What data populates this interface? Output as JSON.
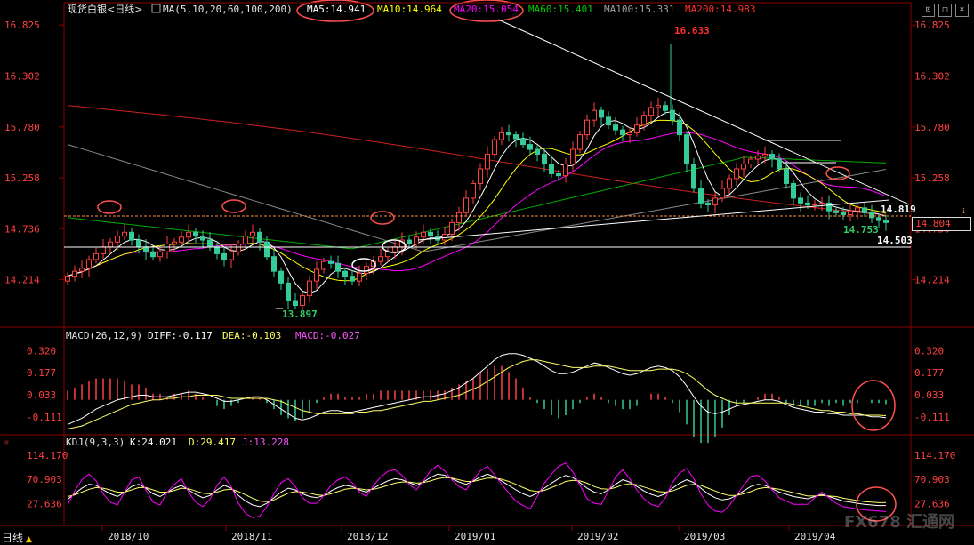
{
  "header": {
    "symbol": "现货白银<日线>",
    "ma_prefix": "MA(5,10,20,60,100,200)",
    "ma_values": [
      {
        "label": "MA5:14.941",
        "color": "#ffffff"
      },
      {
        "label": "MA10:14.964",
        "color": "#ffff00"
      },
      {
        "label": "MA20:15.054",
        "color": "#ff00ff"
      },
      {
        "label": "MA60:15.401",
        "color": "#00cc00"
      },
      {
        "label": "MA100:15.331",
        "color": "#a0a0a0"
      },
      {
        "label": "MA200:14.983",
        "color": "#ff3030"
      }
    ]
  },
  "macd_header": {
    "title": "MACD(26,12,9)",
    "diff": "DIFF:-0.117",
    "dea": "DEA:-0.103",
    "macd": "MACD:-0.027"
  },
  "kdj_header": {
    "title": "KDJ(9,3,3)",
    "k": "K:24.021",
    "d": "D:29.417",
    "j": "J:13.228"
  },
  "bottom_tab": "日线",
  "watermark": "FX678 汇通网",
  "price_tag": "14.804",
  "chart_data": [
    {
      "type": "candlestick",
      "panel": "price",
      "y_ticks": [
        "16.825",
        "16.302",
        "15.780",
        "15.258",
        "14.736",
        "14.214"
      ],
      "ylim": [
        13.8,
        16.9
      ],
      "x_ticks": [
        "2018/10",
        "2018/11",
        "2018/12",
        "2019/01",
        "2019/02",
        "2019/03",
        "2019/04"
      ],
      "annotations": [
        {
          "text": "16.633",
          "color": "#ff3030"
        },
        {
          "text": "13.897",
          "color": "#33cc66"
        },
        {
          "text": "14.819",
          "color": "#ffffff"
        },
        {
          "text": "14.753",
          "color": "#33cc66"
        },
        {
          "text": "14.503",
          "color": "#ffffff"
        }
      ],
      "closes": [
        14.25,
        14.3,
        14.33,
        14.42,
        14.48,
        14.55,
        14.6,
        14.66,
        14.7,
        14.62,
        14.55,
        14.5,
        14.45,
        14.5,
        14.58,
        14.6,
        14.65,
        14.7,
        14.66,
        14.62,
        14.55,
        14.48,
        14.42,
        14.5,
        14.58,
        14.66,
        14.7,
        14.6,
        14.45,
        14.3,
        14.18,
        14.0,
        13.95,
        14.05,
        14.2,
        14.32,
        14.4,
        14.38,
        14.3,
        14.25,
        14.2,
        14.28,
        14.35,
        14.4,
        14.45,
        14.5,
        14.55,
        14.62,
        14.58,
        14.65,
        14.7,
        14.66,
        14.62,
        14.68,
        14.8,
        14.9,
        15.05,
        15.2,
        15.35,
        15.5,
        15.65,
        15.72,
        15.7,
        15.66,
        15.6,
        15.55,
        15.5,
        15.4,
        15.3,
        15.28,
        15.4,
        15.55,
        15.7,
        15.85,
        15.95,
        15.88,
        15.8,
        15.75,
        15.7,
        15.72,
        15.8,
        15.9,
        15.98,
        16.0,
        15.95,
        15.85,
        15.7,
        15.4,
        15.15,
        15.0,
        14.98,
        15.05,
        15.15,
        15.25,
        15.35,
        15.4,
        15.45,
        15.48,
        15.5,
        15.45,
        15.35,
        15.2,
        15.05,
        15.0,
        14.98,
        14.99,
        15.0,
        14.92,
        14.9,
        14.88,
        14.92,
        14.95,
        14.9,
        14.85,
        14.82,
        14.8
      ]
    },
    {
      "type": "bar+line",
      "panel": "macd",
      "y_ticks": [
        "0.320",
        "0.177",
        "0.033",
        "-0.111"
      ],
      "ylim": [
        -0.21,
        0.38
      ],
      "series": [
        {
          "name": "DIFF",
          "color": "#ffffff",
          "values": [
            -0.16,
            -0.14,
            -0.12,
            -0.09,
            -0.06,
            -0.04,
            -0.02,
            0.0,
            0.01,
            0.02,
            0.03,
            0.03,
            0.02,
            0.02,
            0.02,
            0.03,
            0.04,
            0.05,
            0.05,
            0.04,
            0.03,
            0.01,
            -0.01,
            -0.01,
            0.0,
            0.01,
            0.02,
            0.02,
            0.0,
            -0.03,
            -0.06,
            -0.09,
            -0.12,
            -0.13,
            -0.12,
            -0.1,
            -0.08,
            -0.07,
            -0.07,
            -0.08,
            -0.08,
            -0.07,
            -0.06,
            -0.05,
            -0.04,
            -0.03,
            -0.02,
            -0.01,
            0.0,
            0.01,
            0.02,
            0.02,
            0.03,
            0.04,
            0.06,
            0.08,
            0.11,
            0.14,
            0.18,
            0.22,
            0.26,
            0.29,
            0.3,
            0.3,
            0.29,
            0.27,
            0.25,
            0.22,
            0.19,
            0.17,
            0.17,
            0.18,
            0.2,
            0.22,
            0.24,
            0.23,
            0.21,
            0.19,
            0.17,
            0.16,
            0.17,
            0.19,
            0.21,
            0.22,
            0.21,
            0.19,
            0.15,
            0.09,
            0.02,
            -0.04,
            -0.08,
            -0.09,
            -0.08,
            -0.06,
            -0.04,
            -0.03,
            -0.02,
            -0.01,
            0.0,
            0.0,
            -0.01,
            -0.03,
            -0.05,
            -0.06,
            -0.07,
            -0.08,
            -0.08,
            -0.09,
            -0.09,
            -0.1,
            -0.1,
            -0.1,
            -0.1,
            -0.11,
            -0.11,
            -0.117
          ]
        },
        {
          "name": "DEA",
          "color": "#ffff66",
          "values": [
            -0.19,
            -0.18,
            -0.17,
            -0.15,
            -0.13,
            -0.11,
            -0.09,
            -0.07,
            -0.05,
            -0.03,
            -0.02,
            -0.01,
            0.0,
            0.0,
            0.01,
            0.01,
            0.02,
            0.02,
            0.03,
            0.03,
            0.03,
            0.03,
            0.02,
            0.01,
            0.01,
            0.01,
            0.01,
            0.01,
            0.01,
            0.0,
            -0.01,
            -0.03,
            -0.05,
            -0.07,
            -0.08,
            -0.09,
            -0.09,
            -0.09,
            -0.09,
            -0.09,
            -0.09,
            -0.08,
            -0.08,
            -0.07,
            -0.07,
            -0.06,
            -0.05,
            -0.04,
            -0.03,
            -0.02,
            -0.01,
            -0.01,
            0.0,
            0.01,
            0.02,
            0.03,
            0.05,
            0.07,
            0.09,
            0.12,
            0.15,
            0.18,
            0.21,
            0.23,
            0.25,
            0.26,
            0.26,
            0.25,
            0.24,
            0.23,
            0.22,
            0.21,
            0.21,
            0.21,
            0.22,
            0.22,
            0.22,
            0.21,
            0.2,
            0.19,
            0.19,
            0.19,
            0.19,
            0.2,
            0.2,
            0.2,
            0.19,
            0.17,
            0.14,
            0.1,
            0.06,
            0.03,
            0.01,
            -0.01,
            -0.02,
            -0.02,
            -0.02,
            -0.02,
            -0.02,
            -0.02,
            -0.02,
            -0.02,
            -0.03,
            -0.04,
            -0.05,
            -0.06,
            -0.07,
            -0.07,
            -0.08,
            -0.08,
            -0.09,
            -0.09,
            -0.1,
            -0.1,
            -0.1,
            -0.103
          ]
        }
      ]
    },
    {
      "type": "line",
      "panel": "kdj",
      "y_ticks": [
        "114.170",
        "70.903",
        "27.636"
      ],
      "ylim": [
        -10,
        125
      ],
      "series": [
        {
          "name": "K",
          "color": "#ffffff",
          "values": [
            35,
            45,
            55,
            62,
            60,
            52,
            45,
            40,
            48,
            58,
            62,
            55,
            45,
            40,
            48,
            55,
            60,
            52,
            44,
            38,
            42,
            52,
            60,
            55,
            42,
            32,
            25,
            22,
            28,
            38,
            48,
            55,
            52,
            45,
            40,
            38,
            42,
            50,
            56,
            60,
            58,
            52,
            48,
            55,
            62,
            68,
            72,
            70,
            65,
            60,
            66,
            74,
            80,
            78,
            72,
            66,
            62,
            68,
            75,
            80,
            75,
            68,
            60,
            52,
            45,
            40,
            46,
            55,
            64,
            72,
            78,
            74,
            65,
            55,
            48,
            45,
            52,
            62,
            70,
            66,
            58,
            50,
            44,
            40,
            45,
            55,
            64,
            70,
            65,
            55,
            45,
            38,
            34,
            36,
            42,
            50,
            58,
            62,
            60,
            54,
            48,
            44,
            40,
            38,
            36,
            40,
            44,
            40,
            36,
            32,
            30,
            28,
            26,
            25,
            24,
            24
          ]
        },
        {
          "name": "D",
          "color": "#ffff66",
          "values": [
            40,
            43,
            48,
            53,
            56,
            55,
            52,
            48,
            48,
            52,
            56,
            56,
            52,
            48,
            48,
            51,
            55,
            54,
            50,
            46,
            45,
            48,
            52,
            53,
            49,
            43,
            37,
            32,
            31,
            34,
            40,
            46,
            49,
            48,
            46,
            43,
            42,
            45,
            49,
            53,
            55,
            54,
            52,
            53,
            56,
            60,
            64,
            66,
            66,
            64,
            65,
            68,
            72,
            74,
            73,
            70,
            67,
            67,
            70,
            73,
            73,
            71,
            67,
            62,
            56,
            51,
            49,
            51,
            56,
            61,
            67,
            69,
            68,
            64,
            58,
            54,
            53,
            56,
            61,
            63,
            61,
            57,
            53,
            49,
            48,
            50,
            55,
            60,
            62,
            60,
            55,
            50,
            45,
            42,
            42,
            45,
            49,
            54,
            56,
            55,
            53,
            50,
            47,
            44,
            41,
            41,
            42,
            41,
            40,
            37,
            35,
            33,
            31,
            30,
            29,
            29.4
          ]
        },
        {
          "name": "J",
          "color": "#ff00ff",
          "values": [
            25,
            50,
            70,
            80,
            68,
            45,
            30,
            25,
            48,
            70,
            75,
            52,
            30,
            25,
            48,
            62,
            72,
            48,
            30,
            22,
            35,
            60,
            75,
            58,
            28,
            10,
            2,
            5,
            22,
            45,
            65,
            72,
            58,
            38,
            28,
            28,
            42,
            60,
            70,
            75,
            65,
            48,
            40,
            60,
            75,
            85,
            88,
            78,
            62,
            52,
            68,
            86,
            96,
            86,
            70,
            58,
            52,
            70,
            86,
            94,
            79,
            62,
            46,
            32,
            24,
            18,
            40,
            64,
            80,
            94,
            100,
            84,
            60,
            36,
            28,
            26,
            50,
            75,
            88,
            72,
            52,
            36,
            26,
            22,
            38,
            65,
            82,
            90,
            72,
            45,
            25,
            14,
            12,
            24,
            42,
            60,
            76,
            78,
            68,
            52,
            38,
            32,
            26,
            26,
            26,
            38,
            48,
            38,
            28,
            22,
            20,
            18,
            16,
            15,
            14,
            13.2
          ]
        }
      ]
    }
  ]
}
